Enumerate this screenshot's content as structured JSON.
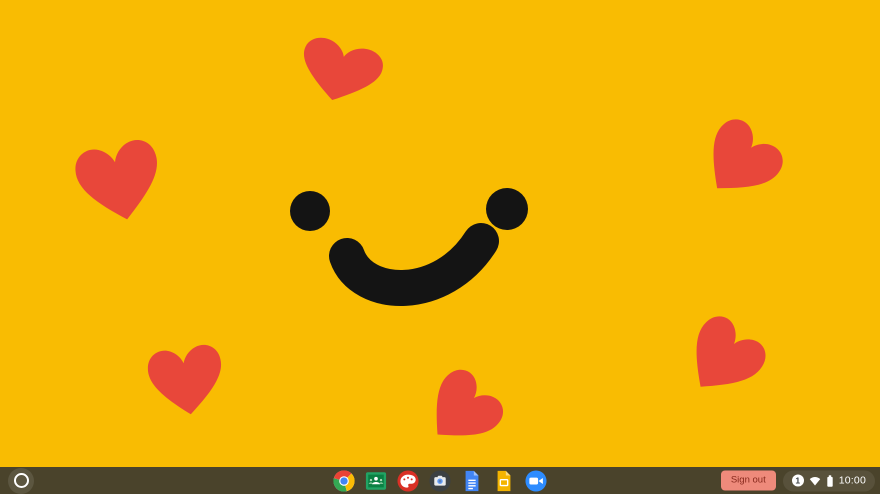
{
  "wallpaper": {
    "background_color": "#F9BC02",
    "heart_color": "#E8473A",
    "face_color": "#141414",
    "heart_count": 6
  },
  "shelf": {
    "background_color": "#4A432B",
    "launcher": {
      "icon": "launcher-icon"
    },
    "apps": [
      {
        "icon": "chrome-icon",
        "name": "Chrome"
      },
      {
        "icon": "classroom-icon",
        "name": "Classroom"
      },
      {
        "icon": "canvas-icon",
        "name": "Canvas"
      },
      {
        "icon": "camera-icon",
        "name": "Camera"
      },
      {
        "icon": "docs-icon",
        "name": "Docs"
      },
      {
        "icon": "slides-icon",
        "name": "Slides"
      },
      {
        "icon": "meet-icon",
        "name": "Meet"
      }
    ],
    "sign_out": {
      "label": "Sign out",
      "background_color": "#EE8A7B",
      "text_color": "#87281C"
    },
    "status": {
      "notification_count": "1",
      "icons": [
        "wifi-icon",
        "battery-icon"
      ],
      "time": "10:00"
    }
  }
}
